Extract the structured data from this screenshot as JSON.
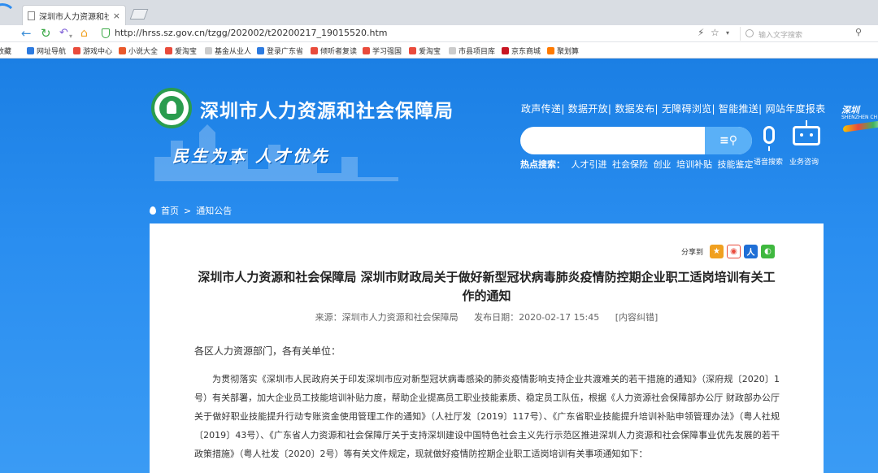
{
  "browser": {
    "tab_title": "深圳市人力资源和社会保",
    "tab_close": "×",
    "url": "http://hrss.sz.gov.cn/tzgg/202002/t20200217_19015520.htm",
    "search_placeholder": "输入文字搜索",
    "bookmarks": [
      {
        "label": "收藏",
        "color": "#f5b800"
      },
      {
        "label": "网址导航",
        "color": "#2d7be0"
      },
      {
        "label": "游戏中心",
        "color": "#e94b3c"
      },
      {
        "label": "小说大全",
        "color": "#e9592b"
      },
      {
        "label": "爱淘宝",
        "color": "#e94b3c"
      },
      {
        "label": "基金从业人",
        "color": "#cccccc"
      },
      {
        "label": "登录广东省",
        "color": "#2d7be0"
      },
      {
        "label": "倾听者复读",
        "color": "#e94b3c"
      },
      {
        "label": "学习强国",
        "color": "#e94b3c"
      },
      {
        "label": "爱淘宝",
        "color": "#e94b3c"
      },
      {
        "label": "市县项目库",
        "color": "#cccccc"
      },
      {
        "label": "京东商城",
        "color": "#c81623"
      },
      {
        "label": "聚划算",
        "color": "#ff7a00"
      }
    ]
  },
  "site": {
    "title": "深圳市人力资源和社会保障局",
    "slogan": "民生为本 人才优先",
    "top_links": "政声传递| 数据开放| 数据发布| 无障碍浏览| 智能推送| 网站年度报表",
    "sz_logo_text": "深圳",
    "sz_logo_sub": "SHENZHEN CH",
    "hot_label": "热点搜索：",
    "hot_items": [
      "人才引进",
      "社会保险",
      "创业",
      "培训补贴",
      "技能鉴定"
    ],
    "voice_label": "语音搜索",
    "consult_label": "业务咨询"
  },
  "breadcrumb": {
    "home": "首页",
    "sep": ">",
    "current": "通知公告"
  },
  "article": {
    "share_label": "分享到",
    "title": "深圳市人力资源和社会保障局 深圳市财政局关于做好新型冠状病毒肺炎疫情防控期企业职工适岗培训有关工作的通知",
    "source": "来源：深圳市人力资源和社会保障局",
    "date": "发布日期：2020-02-17 15:45",
    "correction": "[内容纠错]",
    "salutation": "各区人力资源部门，各有关单位：",
    "body": "为贯彻落实《深圳市人民政府关于印发深圳市应对新型冠状病毒感染的肺炎疫情影响支持企业共渡难关的若干措施的通知》（深府规〔2020〕1号）有关部署，加大企业员工技能培训补贴力度，帮助企业提高员工职业技能素质、稳定员工队伍，根据《人力资源社会保障部办公厅 财政部办公厅关于做好职业技能提升行动专账资金使用管理工作的通知》（人社厅发〔2019〕117号）、《广东省职业技能提升培训补贴申领管理办法》（粤人社规〔2019〕43号）、《广东省人力资源和社会保障厅关于支持深圳建设中国特色社会主义先行示范区推进深圳人力资源和社会保障事业优先发展的若干政策措施》（粤人社发〔2020〕2号）等有关文件规定，现就做好疫情防控期企业职工适岗培训有关事项通知如下："
  }
}
